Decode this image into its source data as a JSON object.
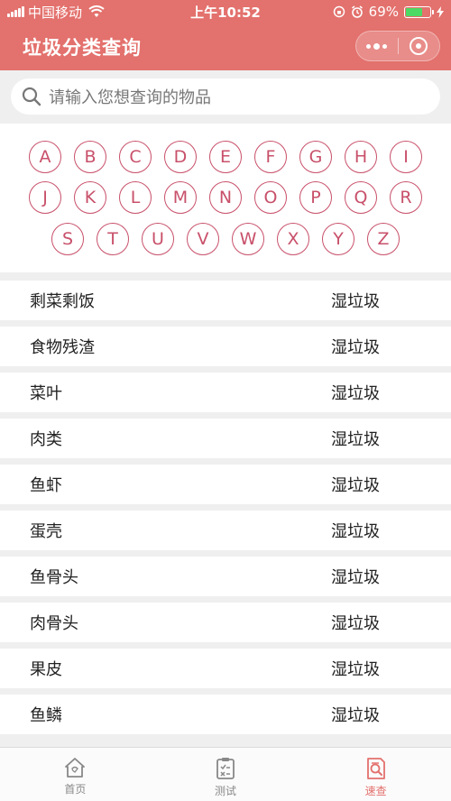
{
  "status_bar": {
    "carrier": "中国移动",
    "time": "上午10:52",
    "battery": "69%",
    "battery_level": 0.69
  },
  "nav": {
    "title": "垃圾分类查询",
    "more_icon": "more-dots-icon",
    "close_icon": "close-circle-icon"
  },
  "search": {
    "placeholder": "请输入您想查询的物品",
    "icon": "search-icon"
  },
  "letters": {
    "row1": [
      "A",
      "B",
      "C",
      "D",
      "E",
      "F",
      "G",
      "H",
      "I"
    ],
    "row2": [
      "J",
      "K",
      "L",
      "M",
      "N",
      "O",
      "P",
      "Q",
      "R"
    ],
    "row3": [
      "S",
      "T",
      "U",
      "V",
      "W",
      "X",
      "Y",
      "Z"
    ]
  },
  "items": [
    {
      "name": "剩菜剩饭",
      "category": "湿垃圾"
    },
    {
      "name": "食物残渣",
      "category": "湿垃圾"
    },
    {
      "name": "菜叶",
      "category": "湿垃圾"
    },
    {
      "name": "肉类",
      "category": "湿垃圾"
    },
    {
      "name": "鱼虾",
      "category": "湿垃圾"
    },
    {
      "name": "蛋壳",
      "category": "湿垃圾"
    },
    {
      "name": "鱼骨头",
      "category": "湿垃圾"
    },
    {
      "name": "肉骨头",
      "category": "湿垃圾"
    },
    {
      "name": "果皮",
      "category": "湿垃圾"
    },
    {
      "name": "鱼鳞",
      "category": "湿垃圾"
    }
  ],
  "tabs": [
    {
      "label": "首页",
      "icon": "home-icon",
      "active": false
    },
    {
      "label": "测试",
      "icon": "clipboard-check-icon",
      "active": false
    },
    {
      "label": "速查",
      "icon": "search-document-icon",
      "active": true
    }
  ],
  "colors": {
    "accent": "#e3716d",
    "letter": "#c8506a",
    "battery_fill": "#4cd964"
  }
}
